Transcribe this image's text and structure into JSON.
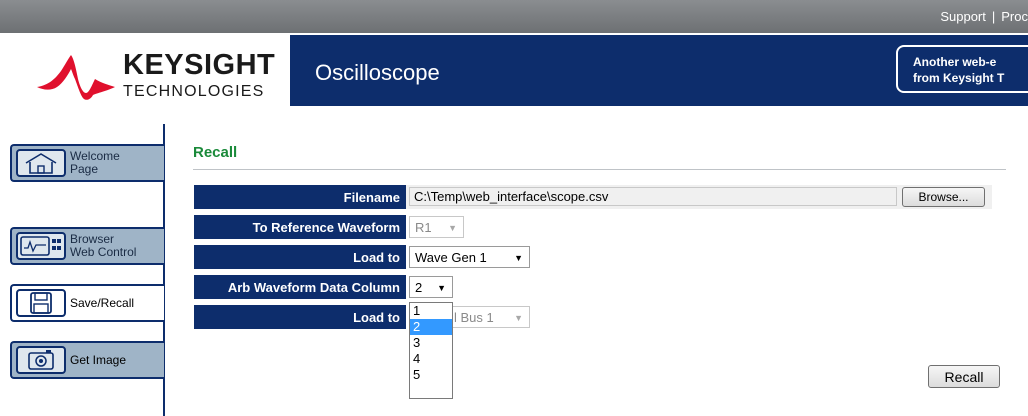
{
  "topbar": {
    "links": [
      "Support",
      "Proc"
    ]
  },
  "header": {
    "logo_word": "KEYSIGHT",
    "logo_sub": "TECHNOLOGIES",
    "app_title": "Oscilloscope",
    "promo_line1": "Another web-e",
    "promo_line2": "from Keysight T"
  },
  "sidebar": {
    "items": [
      {
        "label_line1": "Welcome",
        "label_line2": "Page",
        "icon": "home-icon"
      },
      {
        "label_line1": "Browser",
        "label_line2": "Web Control",
        "icon": "oscilloscope-icon"
      },
      {
        "label": "Save/Recall",
        "icon": "floppy-disk-icon",
        "active": true
      },
      {
        "label": "Get Image",
        "icon": "camera-icon"
      }
    ]
  },
  "main": {
    "section_title": "Recall",
    "rows": {
      "filename_label": "Filename",
      "filename_value": "C:\\Temp\\web_interface\\scope.csv",
      "browse_label": "Browse...",
      "ref_label": "To Reference Waveform",
      "ref_value": "R1",
      "load_to_label": "Load to",
      "load_to_value": "Wave Gen 1",
      "arb_label": "Arb Waveform Data Column",
      "arb_value": "2",
      "load_to2_label": "Load to",
      "load_to2_value_visible": "l Bus 1"
    },
    "dropdown_options": [
      "1",
      "2",
      "3",
      "4",
      "5"
    ],
    "dropdown_selected": "2",
    "recall_label": "Recall"
  },
  "colors": {
    "navy": "#0d2d6c",
    "accent_red": "#e0102d",
    "title_green": "#1a8a3a",
    "nav_blue": "#9fb4c7"
  }
}
